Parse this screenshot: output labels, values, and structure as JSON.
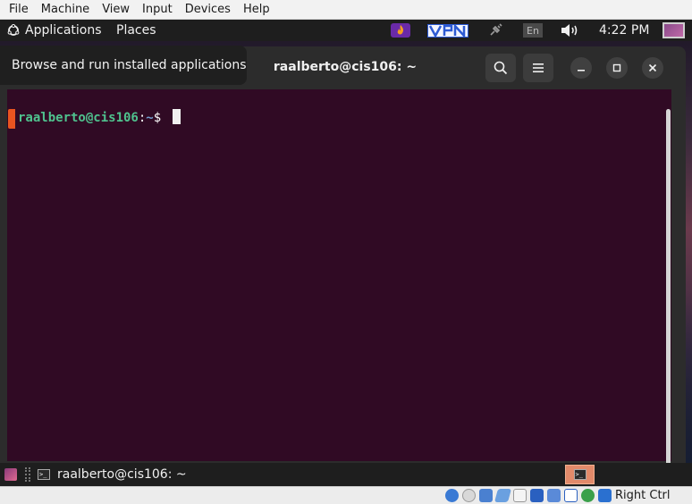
{
  "vbox_menu": [
    "File",
    "Machine",
    "View",
    "Input",
    "Devices",
    "Help"
  ],
  "panel": {
    "applications_label": "Applications",
    "places_label": "Places",
    "language": "En",
    "clock": "4:22 PM"
  },
  "tooltip": "Browse and run installed applications",
  "terminal": {
    "title": "raalberto@cis106: ~",
    "prompt_user": "raalberto@cis106",
    "prompt_colon": ":",
    "prompt_path": "~",
    "prompt_symbol": "$"
  },
  "taskbar": {
    "window_label": "raalberto@cis106: ~"
  },
  "vbox_status": {
    "host_key": "Right Ctrl"
  },
  "colors": {
    "terminal_bg": "#300a24",
    "prompt_user": "#4fc28e",
    "prompt_path": "#729fcf",
    "accent": "#e95420"
  },
  "icons": {
    "applications": "applications-icon",
    "search": "search-icon",
    "menu": "hamburger-menu-icon",
    "minimize": "minimize-icon",
    "maximize": "maximize-icon",
    "close": "close-icon",
    "volume": "volume-icon",
    "network": "network-plug-icon"
  }
}
